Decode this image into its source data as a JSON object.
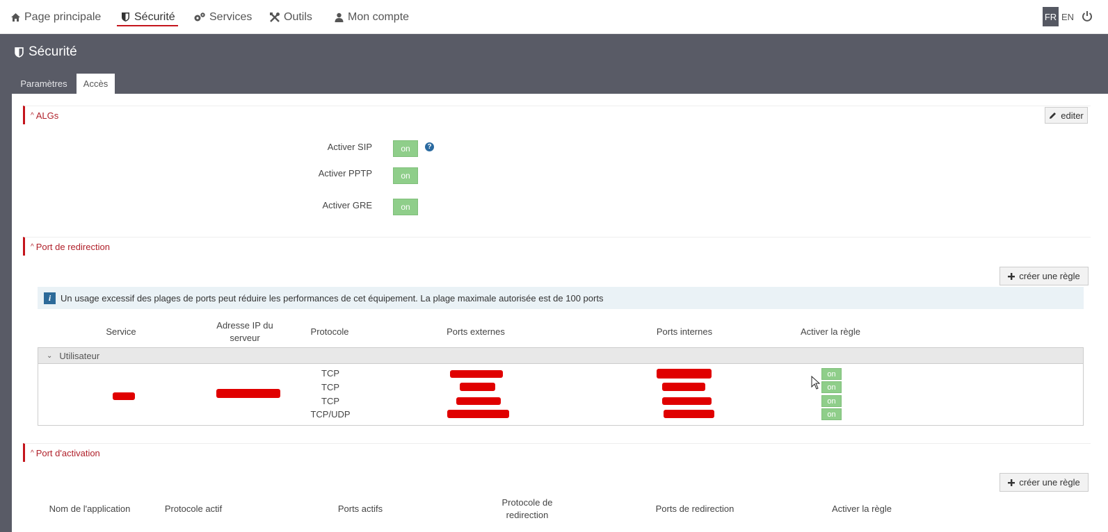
{
  "nav": {
    "items": [
      {
        "label": "Page principale",
        "icon": "home-icon"
      },
      {
        "label": "Sécurité",
        "icon": "shield-icon"
      },
      {
        "label": "Services",
        "icon": "gears-icon"
      },
      {
        "label": "Outils",
        "icon": "tools-icon"
      },
      {
        "label": "Mon compte",
        "icon": "user-icon"
      }
    ],
    "active_index": 1,
    "languages": [
      "FR",
      "EN"
    ],
    "active_language": "FR"
  },
  "page": {
    "title": "Sécurité",
    "tabs": [
      {
        "label": "Paramètres"
      },
      {
        "label": "Accès"
      }
    ],
    "active_tab": 1
  },
  "algs": {
    "title": "ALGs",
    "edit_label": "editer",
    "fields": [
      {
        "label": "Activer SIP",
        "value": "on",
        "has_help": true
      },
      {
        "label": "Activer PPTP",
        "value": "on"
      },
      {
        "label": "Activer GRE",
        "value": "on"
      }
    ],
    "help_glyph": "?"
  },
  "port_forward": {
    "title": "Port de redirection",
    "create_label": "créer une règle",
    "info_text": "Un usage excessif des plages de ports peut réduire les performances de cet équipement. La plage maximale autorisée est de 100 ports",
    "info_glyph": "i",
    "columns": {
      "service": "Service",
      "server_ip": "Adresse IP du serveur",
      "protocol": "Protocole",
      "external_ports": "Ports externes",
      "internal_ports": "Ports internes",
      "enable_rule": "Activer la règle"
    },
    "group": "Utilisateur",
    "rules": [
      {
        "protocol": "TCP",
        "enabled": "on"
      },
      {
        "protocol": "TCP",
        "enabled": "on"
      },
      {
        "protocol": "TCP",
        "enabled": "on"
      },
      {
        "protocol": "TCP/UDP",
        "enabled": "on"
      }
    ]
  },
  "port_trigger": {
    "title": "Port d'activation",
    "create_label": "créer une règle",
    "columns": {
      "app_name": "Nom de l'application",
      "active_protocol": "Protocole actif",
      "active_ports": "Ports actifs",
      "redirect_protocol": "Protocole de redirection",
      "redirect_ports": "Ports de redirection",
      "enable_rule": "Activer la règle"
    }
  },
  "colors": {
    "accent": "#c4151c",
    "band": "#595b66",
    "toggle_on": "#8fce8a",
    "info_bg": "#eaf2f6"
  }
}
